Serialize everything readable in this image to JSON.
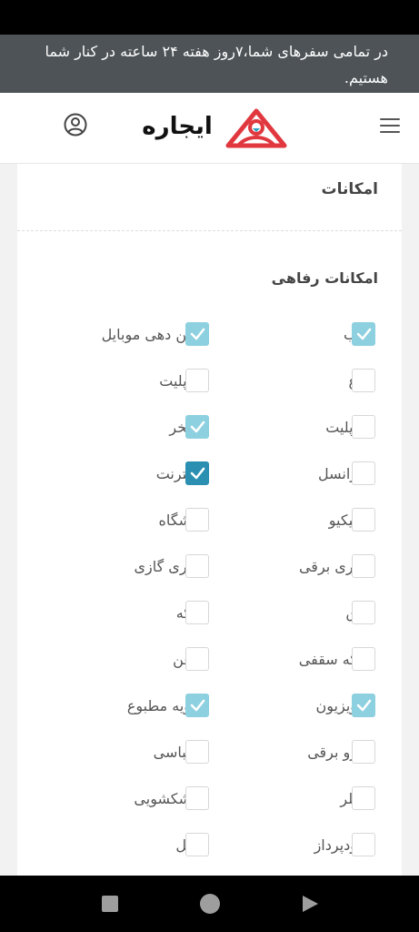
{
  "notice": {
    "text": "در تمامی سفرهای شما،۷روز هفته ۲۴ ساعته در کنار شما هستیم."
  },
  "header": {
    "logo_text": "ایجاره",
    "brand_color": "#e0383e"
  },
  "facilities": {
    "title": "امکانات",
    "subtitle": "امکانات رفاهی",
    "check_color_light": "#8dd0e0",
    "check_color_dark": "#2a8fb1",
    "rows": [
      {
        "right": {
          "label": "ب",
          "checked": true
        },
        "left": {
          "label": "تن دهی موبایل",
          "checked": true
        }
      },
      {
        "right": {
          "label": "ع",
          "checked": false
        },
        "left": {
          "label": "اپلیت",
          "checked": false
        }
      },
      {
        "right": {
          "label": "اپلیت",
          "checked": false
        },
        "left": {
          "label": "تخر",
          "checked": true
        }
      },
      {
        "right": {
          "label": "رانسل",
          "checked": false
        },
        "left": {
          "label": "نترنت",
          "checked": true,
          "strong": true
        }
      },
      {
        "right": {
          "label": "بیکیو",
          "checked": false
        },
        "left": {
          "label": "شگاه",
          "checked": false
        }
      },
      {
        "right": {
          "label": "اری برقی",
          "checked": false
        },
        "left": {
          "label": "اری گازی",
          "checked": false
        }
      },
      {
        "right": {
          "label": "ق",
          "checked": false
        },
        "left": {
          "label": "که",
          "checked": false
        }
      },
      {
        "right": {
          "label": "که سقفی",
          "checked": false
        },
        "left": {
          "label": "فن",
          "checked": false
        }
      },
      {
        "right": {
          "label": "ویزیون",
          "checked": true
        },
        "left": {
          "label": "ویه مطبوع",
          "checked": true
        }
      },
      {
        "right": {
          "label": "رو برقی",
          "checked": false
        },
        "left": {
          "label": "لباسی",
          "checked": false
        }
      },
      {
        "right": {
          "label": "بلر",
          "checked": false
        },
        "left": {
          "label": "شکشویی",
          "checked": false
        }
      },
      {
        "right": {
          "label": "ودپرداز",
          "checked": false
        },
        "left": {
          "label": "تل",
          "checked": false
        }
      }
    ]
  }
}
